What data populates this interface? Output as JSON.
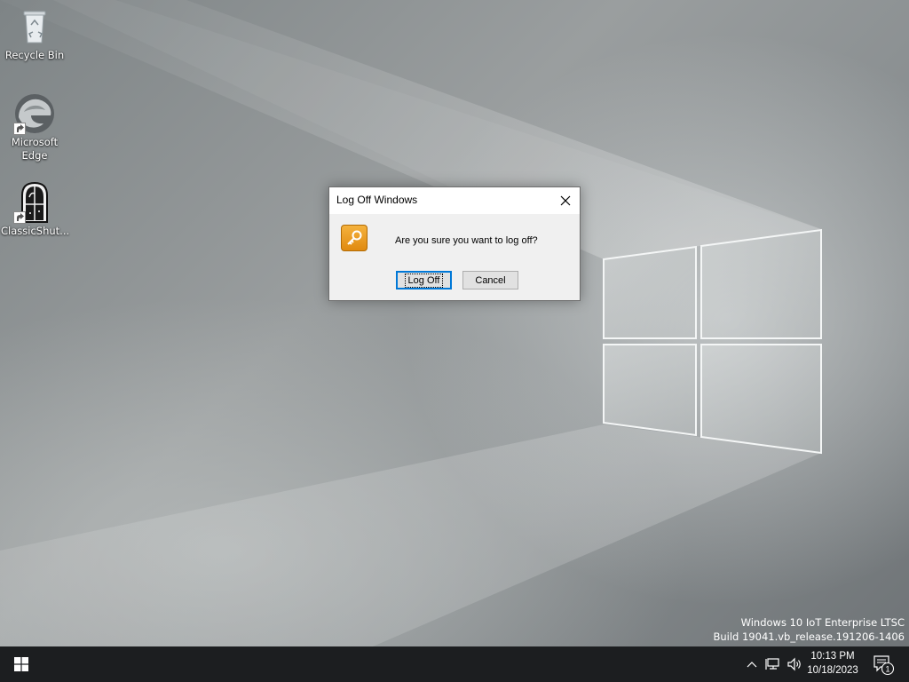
{
  "desktop": {
    "icons": [
      {
        "label": "Recycle Bin",
        "icon": "recycle-bin-icon"
      },
      {
        "label": "Microsoft Edge",
        "icon": "edge-icon"
      },
      {
        "label": "ClassicShut...",
        "icon": "classic-shell-icon"
      }
    ],
    "watermark": {
      "line1": "Windows 10 IoT Enterprise LTSC",
      "line2": "Build 19041.vb_release.191206-1406"
    }
  },
  "dialog": {
    "title": "Log Off Windows",
    "message": "Are you sure you want to log off?",
    "icon": "key-icon",
    "primary_button": "Log Off",
    "secondary_button": "Cancel"
  },
  "taskbar": {
    "clock": {
      "time": "10:13 PM",
      "date": "10/18/2023"
    },
    "notification_count": "1"
  },
  "colors": {
    "accent": "#0078d7",
    "taskbar": "#1c1e20",
    "dialog_bg": "#f0f0f0"
  }
}
